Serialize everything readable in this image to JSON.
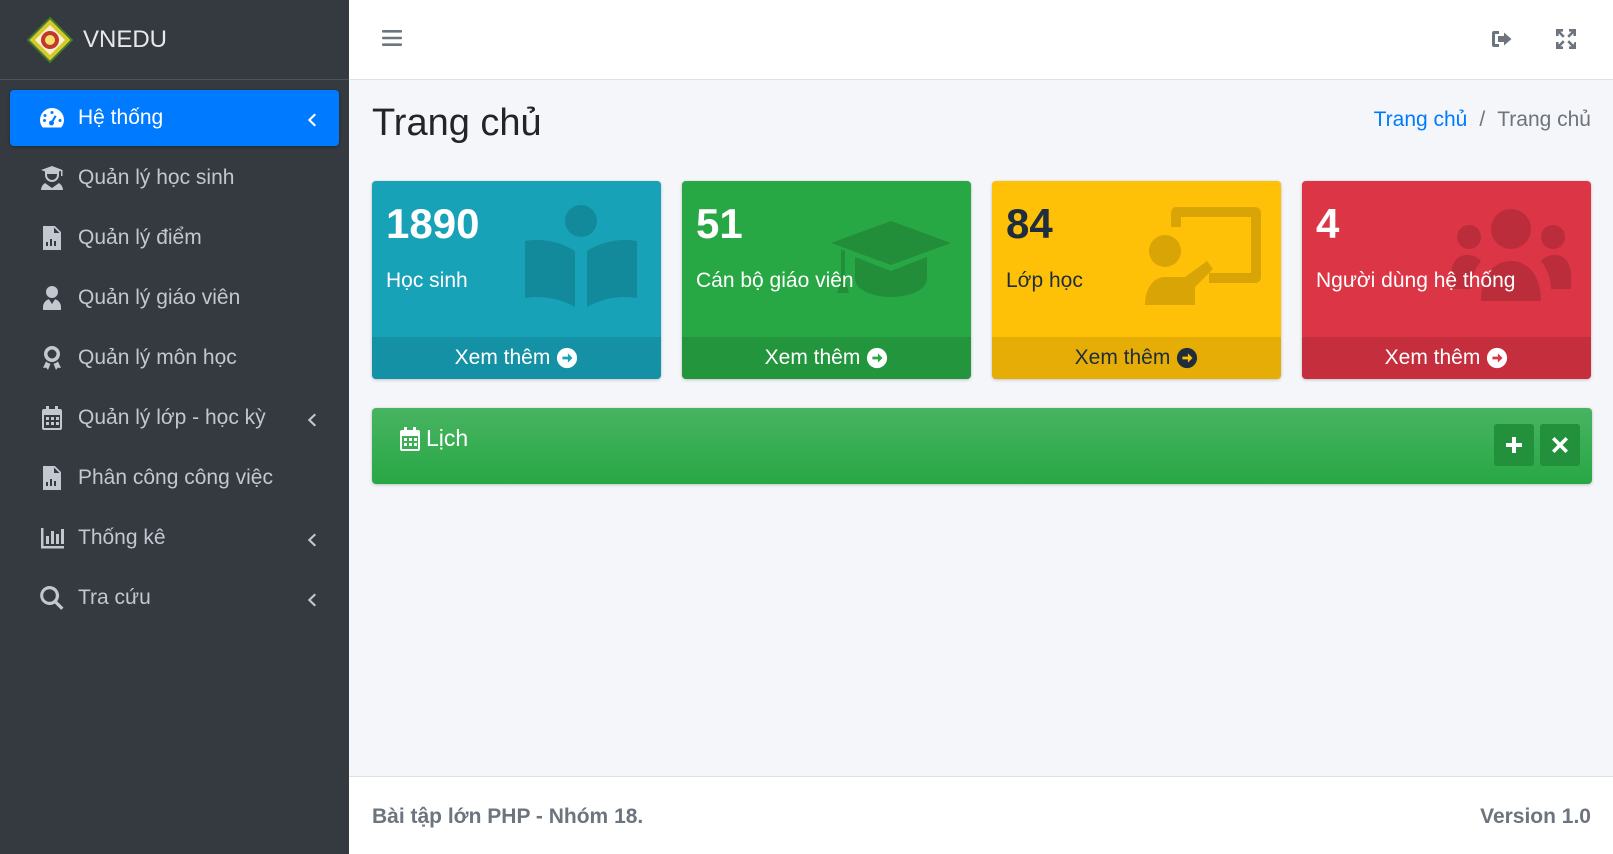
{
  "brand": {
    "name": "VNEDU",
    "logo_icon": "vnedu-logo-icon"
  },
  "sidebar": {
    "items": [
      {
        "label": "Hệ thống",
        "icon": "dashboard-icon",
        "active": true,
        "has_caret": true
      },
      {
        "label": "Quản lý học sinh",
        "icon": "student-icon",
        "has_caret": false
      },
      {
        "label": "Quản lý điểm",
        "icon": "file-chart-icon",
        "has_caret": false
      },
      {
        "label": "Quản lý giáo viên",
        "icon": "teacher-icon",
        "has_caret": false
      },
      {
        "label": "Quản lý môn học",
        "icon": "award-icon",
        "has_caret": false
      },
      {
        "label": "Quản lý lớp - học kỳ",
        "icon": "calendar-icon",
        "has_caret": true
      },
      {
        "label": "Phân công công việc",
        "icon": "file-chart-icon",
        "has_caret": false
      },
      {
        "label": "Thống kê",
        "icon": "bar-chart-icon",
        "has_caret": true
      },
      {
        "label": "Tra cứu",
        "icon": "search-icon",
        "has_caret": true
      }
    ]
  },
  "topbar": {
    "menu_icon": "hamburger-icon",
    "signout_icon": "sign-out-icon",
    "fullscreen_icon": "expand-icon"
  },
  "header": {
    "title": "Trang chủ",
    "breadcrumb": {
      "home": "Trang chủ",
      "separator": "/",
      "current": "Trang chủ"
    }
  },
  "stats": [
    {
      "value": "1890",
      "label": "Học sinh",
      "more": "Xem thêm",
      "color": "#17a2b8",
      "icon": "book-open-icon"
    },
    {
      "value": "51",
      "label": "Cán bộ giáo viên",
      "more": "Xem thêm",
      "color": "#28a745",
      "icon": "graduation-cap-icon"
    },
    {
      "value": "84",
      "label": "Lớp học",
      "more": "Xem thêm",
      "color": "#ffc107",
      "icon": "chalkboard-teacher-icon"
    },
    {
      "value": "4",
      "label": "Người dùng hệ thống",
      "more": "Xem thêm",
      "color": "#dc3545",
      "icon": "users-icon"
    }
  ],
  "calendar": {
    "title": "Lịch",
    "icon": "calendar-icon"
  },
  "footer": {
    "left": "Bài tập lớn PHP - Nhóm 18.",
    "right": "Version 1.0"
  }
}
